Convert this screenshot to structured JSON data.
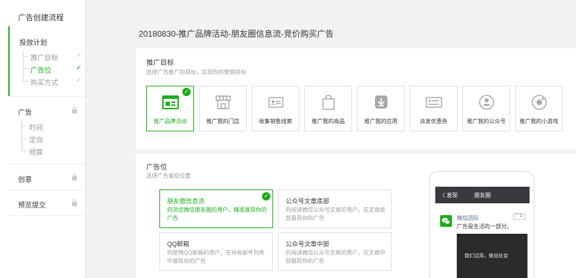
{
  "sidebar": {
    "title": "广告创建流程",
    "sections": [
      {
        "label": "投放计划",
        "items": [
          {
            "label": "推广目标",
            "check": "✓"
          },
          {
            "label": "广告位",
            "check": "✓"
          },
          {
            "label": "购买方式",
            "check": "✓"
          }
        ]
      },
      {
        "label": "广告",
        "items": [
          {
            "label": "时间"
          },
          {
            "label": "定向"
          },
          {
            "label": "预算"
          }
        ]
      },
      {
        "label": "创意"
      },
      {
        "label": "预览提交"
      }
    ]
  },
  "header": {
    "title": "20180830-推广品牌活动-朋友圈信息流-竞价购买广告"
  },
  "goal": {
    "title": "推广目标",
    "desc": "选择广告推广的目标，实现你的营销目标",
    "cards": [
      {
        "label": "推广品牌活动",
        "icon": "brand-activity-icon"
      },
      {
        "label": "推广我的门店",
        "icon": "store-icon"
      },
      {
        "label": "收集销售线索",
        "icon": "sales-lead-icon"
      },
      {
        "label": "推广我的商品",
        "icon": "shopping-bag-icon"
      },
      {
        "label": "推广我的应用",
        "icon": "app-download-icon"
      },
      {
        "label": "派发优惠券",
        "icon": "coupon-icon"
      },
      {
        "label": "推广我的公众号",
        "icon": "official-account-icon"
      },
      {
        "label": "推广我的小游戏",
        "icon": "mini-game-icon"
      }
    ]
  },
  "placement": {
    "title": "广告位",
    "desc": "选择广告展现位置",
    "options": [
      {
        "title": "朋友圈信息流",
        "desc": "向浏览微信朋友圈的用户，精准展现你的广告"
      },
      {
        "title": "公众号文章底部",
        "desc": "向阅读微信公众号文章的用户，在文章底部展现你的广告"
      },
      {
        "title": "QQ邮箱",
        "desc": "向使用QQ邮箱的用户，在待收邮件列表中展现你的广告"
      },
      {
        "title": "公众号文章中部",
        "desc": "向阅读微信公众号文章的用户，在文章中部展现你的广告"
      }
    ]
  },
  "preview": {
    "back": "〈 发现",
    "title": "朋友圈",
    "account": "微信团队",
    "text": "广告是生活的一部分。",
    "tag": "广告",
    "image_text": "我们试用，做自处变"
  },
  "colors": {
    "accent": "#1aad19",
    "nav_bar": "#393a3f",
    "link": "#576b95"
  }
}
